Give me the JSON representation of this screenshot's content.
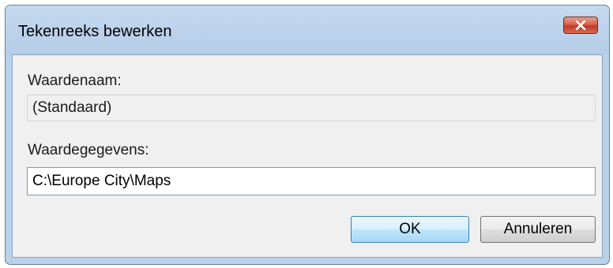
{
  "window": {
    "title": "Tekenreeks bewerken"
  },
  "value_name": {
    "label": "Waardenaam:",
    "value": "(Standaard)"
  },
  "value_data": {
    "label": "Waardegegevens:",
    "value": "C:\\Europe City\\Maps"
  },
  "buttons": {
    "ok_label": "OK",
    "cancel_label": "Annuleren"
  },
  "icons": {
    "close": "close-x-icon"
  },
  "colors": {
    "window_frame": "#b9d1ea",
    "client_background": "#f0f0f0",
    "close_button": "#c0392b",
    "default_button_border": "#3c7fb1"
  }
}
